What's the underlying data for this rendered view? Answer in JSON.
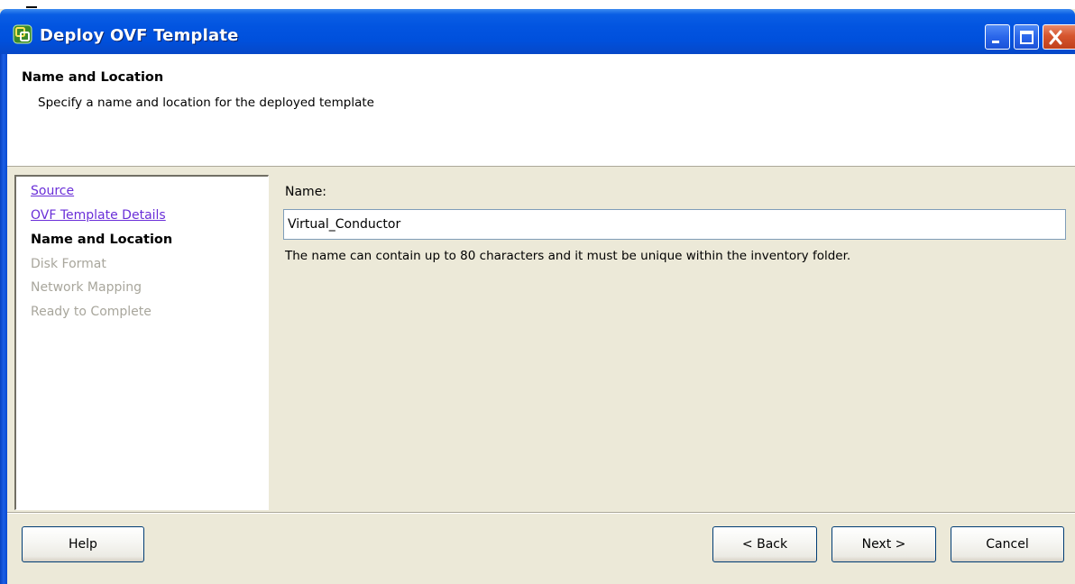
{
  "window": {
    "title": "Deploy OVF Template"
  },
  "header": {
    "title": "Name and Location",
    "subtitle": "Specify a name and location for the deployed template"
  },
  "nav": {
    "items": [
      {
        "label": "Source",
        "state": "link"
      },
      {
        "label": "OVF Template Details",
        "state": "link"
      },
      {
        "label": "Name and Location",
        "state": "current"
      },
      {
        "label": "Disk Format",
        "state": "disabled"
      },
      {
        "label": "Network Mapping",
        "state": "disabled"
      },
      {
        "label": "Ready to Complete",
        "state": "disabled"
      }
    ]
  },
  "main": {
    "name_label": "Name:",
    "name_value": "Virtual_Conductor",
    "name_hint": "The name can contain up to 80 characters and it must be unique within the inventory folder."
  },
  "buttons": {
    "help": "Help",
    "back": "< Back",
    "next": "Next >",
    "cancel": "Cancel"
  },
  "colors": {
    "titlebar": "#0254e0",
    "link": "#6a2fd8",
    "disabled": "#a8a69c",
    "dialog_bg": "#ece9d8"
  },
  "icons": {
    "app": "vsphere-deploy-icon",
    "minimize": "minimize-icon",
    "maximize": "maximize-icon",
    "close": "close-icon"
  }
}
